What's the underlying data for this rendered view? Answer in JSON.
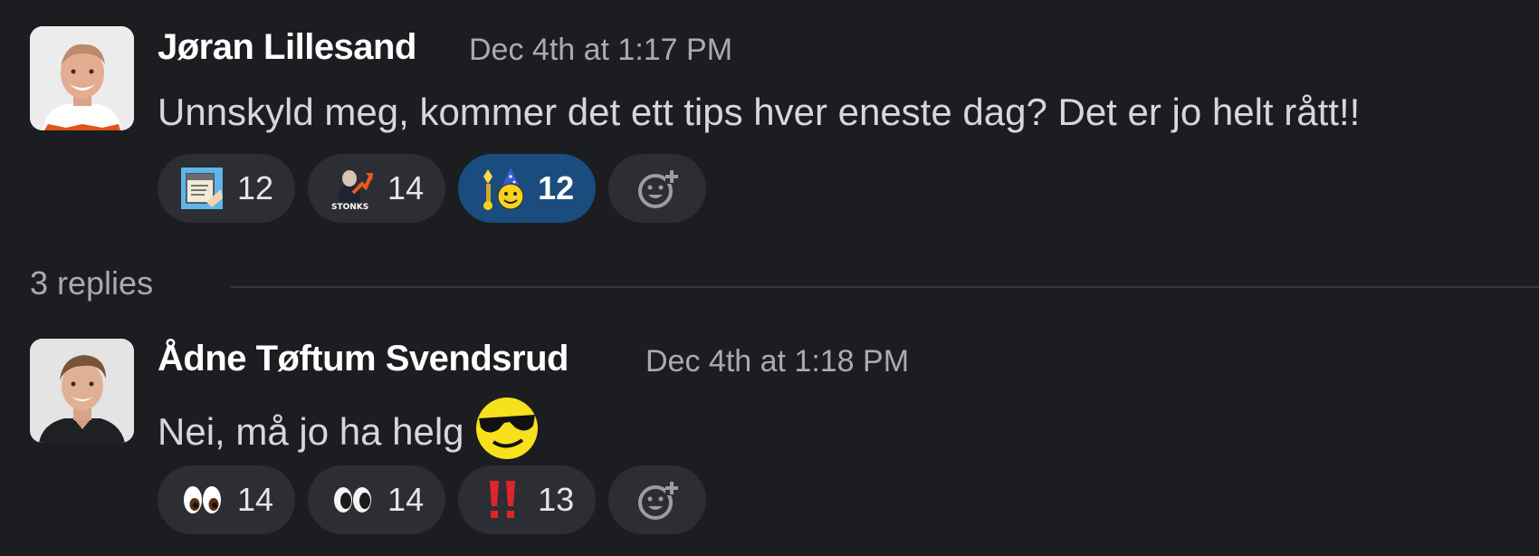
{
  "messages": [
    {
      "author": "Jøran Lillesand",
      "timestamp": "Dec 4th at 1:17 PM",
      "text": "Unnskyld meg, kommer det ett tips hver eneste dag? Det er jo helt rått!!",
      "reactions": [
        {
          "emoji": "document-emoji",
          "count": "12",
          "active": false
        },
        {
          "emoji": "stonks-emoji",
          "count": "14",
          "active": false
        },
        {
          "emoji": "party-wizard-emoji",
          "count": "12",
          "active": true
        }
      ]
    },
    {
      "author": "Ådne Tøftum Svendsrud",
      "timestamp": "Dec 4th at 1:18 PM",
      "text": "Nei, må jo ha helg",
      "text_emoji": "cool-sunglasses-emoji",
      "reactions": [
        {
          "emoji": "eyes-emoji",
          "count": "14",
          "active": false
        },
        {
          "emoji": "eyes-alt-emoji",
          "count": "14",
          "active": false
        },
        {
          "emoji": "double-exclamation-emoji",
          "count": "13",
          "active": false
        }
      ]
    }
  ],
  "thread": {
    "replies_label": "3 replies"
  },
  "colors": {
    "accent": "#1a4d7e",
    "background": "#1b1d21",
    "pill": "#2c2e33"
  }
}
